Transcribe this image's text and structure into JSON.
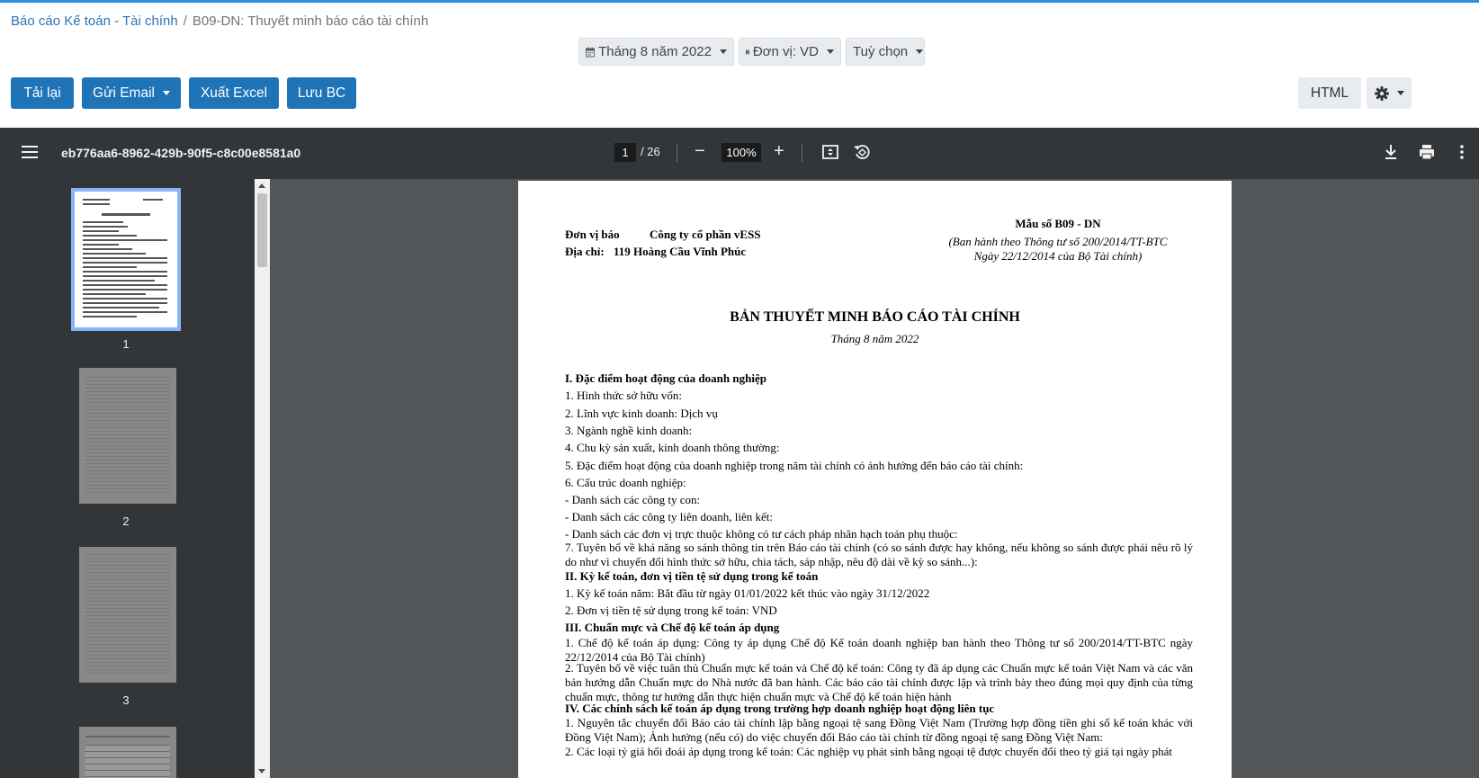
{
  "breadcrumb": {
    "parent": "Báo cáo Kế toán - Tài chính",
    "current": "B09-DN: Thuyết minh báo cáo tài chính"
  },
  "filters": {
    "period": "Tháng 8 năm 2022",
    "unit": "Đơn vị: VD",
    "options": "Tuỳ chọn"
  },
  "toolbar": {
    "reload": "Tải lại",
    "send_email": "Gửi Email",
    "export_excel": "Xuất Excel",
    "save_report": "Lưu BC",
    "html": "HTML"
  },
  "viewer": {
    "doc_name": "eb776aa6-8962-429b-90f5-c8c00e8581a0",
    "current_page": "1",
    "total_pages": "/ 26",
    "zoom": "100%",
    "thumbnails": [
      "1",
      "2",
      "3"
    ]
  },
  "document": {
    "unit_label": "Đơn vị báo",
    "unit_value": "Công ty cổ phần vESS",
    "address_label": "Địa chỉ:",
    "address_value": "119 Hoàng Cầu Vĩnh Phúc",
    "form_no": "Mẫu số B09 - DN",
    "form_note_1": "(Ban hành theo Thông tư số 200/2014/TT-BTC",
    "form_note_2": "Ngày 22/12/2014 của Bộ Tài chính)",
    "title": "BẢN THUYẾT MINH BÁO CÁO TÀI CHÍNH",
    "subtitle": "Tháng 8 năm 2022",
    "sec1": "I. Đặc điểm hoạt động của doanh nghiệp",
    "s1_1": "1. Hình thức sở hữu vốn:",
    "s1_2": "2. Lĩnh vực kinh doanh: Dịch vụ",
    "s1_3": "3. Ngành nghề kinh doanh:",
    "s1_4": "4. Chu kỳ sản xuất, kinh doanh thông thường:",
    "s1_5": "5. Đặc điểm hoạt động của doanh nghiệp trong năm tài chính có ảnh hưởng đến báo cáo tài chính:",
    "s1_6": "6. Cấu trúc doanh nghiệp:",
    "s1_6a": "- Danh sách các công ty con:",
    "s1_6b": "- Danh sách các công ty liên doanh, liên kết:",
    "s1_6c": "- Danh sách các đơn vị trực thuộc không có tư cách pháp nhân hạch toán phụ thuộc:",
    "s1_7": "7. Tuyên bố về khả năng so sánh thông tin trên Báo cáo tài chính (có so sánh được hay không, nếu không so sánh được phải nêu rõ lý do như vì chuyển đổi hình thức sở hữu, chia tách, sáp nhập, nêu độ dài về kỳ so sánh...):",
    "sec2": "II. Kỳ kế toán, đơn vị tiền tệ sử dụng trong kế toán",
    "s2_1": "1. Kỳ kế toán năm: Bắt đầu từ ngày 01/01/2022 kết thúc vào ngày 31/12/2022",
    "s2_2": "2. Đơn vị tiền tệ sử dụng trong kế toán: VND",
    "sec3": "III. Chuẩn mực và Chế độ kế toán áp dụng",
    "s3_1": "1. Chế độ kế toán áp dụng: Công ty áp dụng Chế độ Kế toán doanh nghiệp ban hành theo Thông tư số 200/2014/TT-BTC ngày 22/12/2014 của Bộ Tài chính)",
    "s3_2": "2. Tuyên bố về việc tuân thủ Chuẩn mực kế toán và Chế độ kế toán: Công ty đã áp dụng các Chuẩn mực kế toán Việt Nam và các văn bản hướng dẫn Chuẩn mực do Nhà nước đã ban hành. Các báo cáo tài chính được lập và trình bày theo đúng mọi quy định của từng chuẩn mực, thông tư hướng dẫn thực hiện chuẩn mực và Chế độ kế toán hiện hành",
    "sec4": "IV. Các chính sách kế toán áp dụng trong trường hợp doanh nghiệp hoạt động liên tục",
    "s4_1": "1. Nguyên tắc chuyển đổi Báo cáo tài chính lập bằng ngoại tệ sang Đồng Việt Nam (Trường hợp đồng tiền ghi sổ kế toán khác với Đồng Việt Nam); Ảnh hưởng (nếu có) do việc chuyển đổi Báo cáo tài chính từ đồng ngoại tệ sang Đồng Việt Nam:",
    "s4_2": "2. Các loại tỷ giá hối đoái áp dụng trong kế toán: Các nghiệp vụ phát sinh bằng ngoại tệ được chuyển đổi theo tỷ giá tại ngày phát"
  }
}
